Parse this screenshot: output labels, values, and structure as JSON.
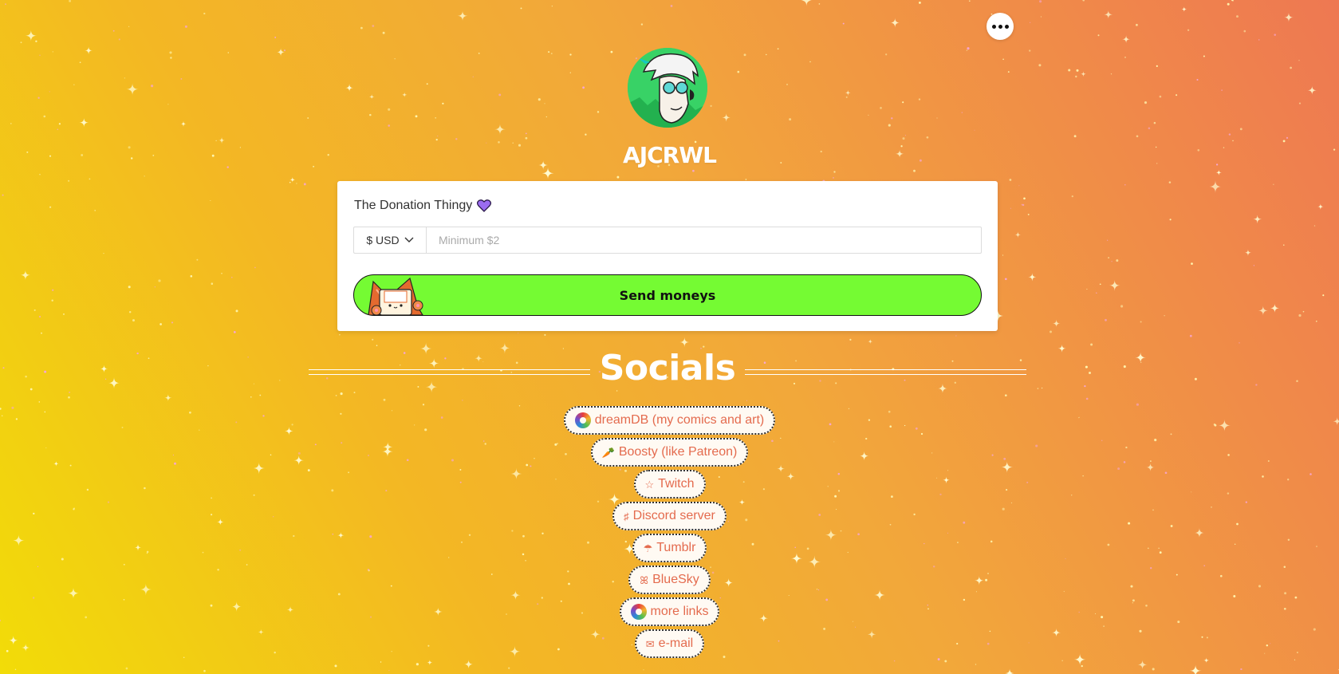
{
  "profile": {
    "username": "AJCRWL",
    "avatar_icon": "avatar-character-art"
  },
  "menu": {
    "more_icon": "ellipsis-icon"
  },
  "donation": {
    "title": "The Donation Thingy",
    "title_icon": "purple-heart-icon",
    "currency_label": "$ USD",
    "currency_icon": "chevron-down-icon",
    "amount_value": "",
    "amount_placeholder": "Minimum $2",
    "send_label": "Send moneys",
    "button_color": "#75fb33"
  },
  "socials": {
    "heading": "Socials",
    "links": [
      {
        "icon": "rainbow-swirl-icon",
        "glyph": "",
        "label": "dreamDB (my comics and art)"
      },
      {
        "icon": "carrot-icon",
        "glyph": "🥕",
        "label": "Boosty (like Patreon)"
      },
      {
        "icon": "star-icon",
        "glyph": "☆",
        "label": "Twitch"
      },
      {
        "icon": "music-sharp-icon",
        "glyph": "♯",
        "label": "Discord server"
      },
      {
        "icon": "umbrella-icon",
        "glyph": "☂",
        "label": "Tumblr"
      },
      {
        "icon": "butterfly-icon",
        "glyph": "ꕤ",
        "label": "BlueSky"
      },
      {
        "icon": "rainbow-swirl-icon",
        "glyph": "",
        "label": "more links"
      },
      {
        "icon": "envelope-icon",
        "glyph": "✉",
        "label": "e-mail"
      }
    ],
    "link_text_color": "#e46b4e"
  },
  "colors": {
    "background_start": "#f2dc08",
    "background_end": "#ee7852"
  }
}
